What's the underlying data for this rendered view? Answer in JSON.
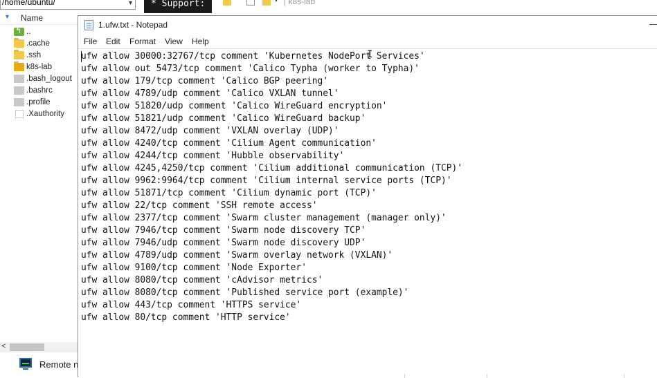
{
  "file_manager": {
    "path": "/home/ubuntu/",
    "column_name": "Name",
    "items": [
      {
        "name": "..",
        "icon": "parent-folder-icon"
      },
      {
        "name": ".cache",
        "icon": "folder-icon"
      },
      {
        "name": ".ssh",
        "icon": "folder-icon"
      },
      {
        "name": "k8s-lab",
        "icon": "folder-icon"
      },
      {
        "name": ".bash_logout",
        "icon": "file-icon"
      },
      {
        "name": ".bashrc",
        "icon": "file-icon"
      },
      {
        "name": ".profile",
        "icon": "file-icon"
      },
      {
        "name": ".Xauthority",
        "icon": "blank-file-icon"
      }
    ],
    "remote_label": "Remote n"
  },
  "topbar": {
    "support_tab": "* Support:",
    "breadcrumb": "| k8s-lab"
  },
  "notepad": {
    "title": "1.ufw.txt - Notepad",
    "menu": [
      "File",
      "Edit",
      "Format",
      "View",
      "Help"
    ],
    "lines": [
      "ufw allow 30000:32767/tcp comment 'Kubernetes NodePort Services'",
      "ufw allow out 5473/tcp comment 'Calico Typha (worker to Typha)'",
      "ufw allow 179/tcp comment 'Calico BGP peering'",
      "ufw allow 4789/udp comment 'Calico VXLAN tunnel'",
      "ufw allow 51820/udp comment 'Calico WireGuard encryption'",
      "ufw allow 51821/udp comment 'Calico WireGuard backup'",
      "ufw allow 8472/udp comment 'VXLAN overlay (UDP)'",
      "ufw allow 4240/tcp comment 'Cilium Agent communication'",
      "ufw allow 4244/tcp comment 'Hubble observability'",
      "ufw allow 4245,4250/tcp comment 'Cilium additional communication (TCP)'",
      "ufw allow 9962:9964/tcp comment 'Cilium internal service ports (TCP)'",
      "ufw allow 51871/tcp comment 'Cilium dynamic port (TCP)'",
      "ufw allow 22/tcp comment 'SSH remote access'",
      "ufw allow 2377/tcp comment 'Swarm cluster management (manager only)'",
      "ufw allow 7946/tcp comment 'Swarm node discovery TCP'",
      "ufw allow 7946/udp comment 'Swarm node discovery UDP'",
      "ufw allow 4789/udp comment 'Swarm overlay network (VXLAN)'",
      "ufw allow 9100/tcp comment 'Node Exporter'",
      "ufw allow 8080/tcp comment 'cAdvisor metrics'",
      "ufw allow 8080/tcp comment 'Published service port (example)'",
      "ufw allow 443/tcp comment 'HTTPS service'",
      "ufw allow 80/tcp comment 'HTTP service'"
    ]
  }
}
